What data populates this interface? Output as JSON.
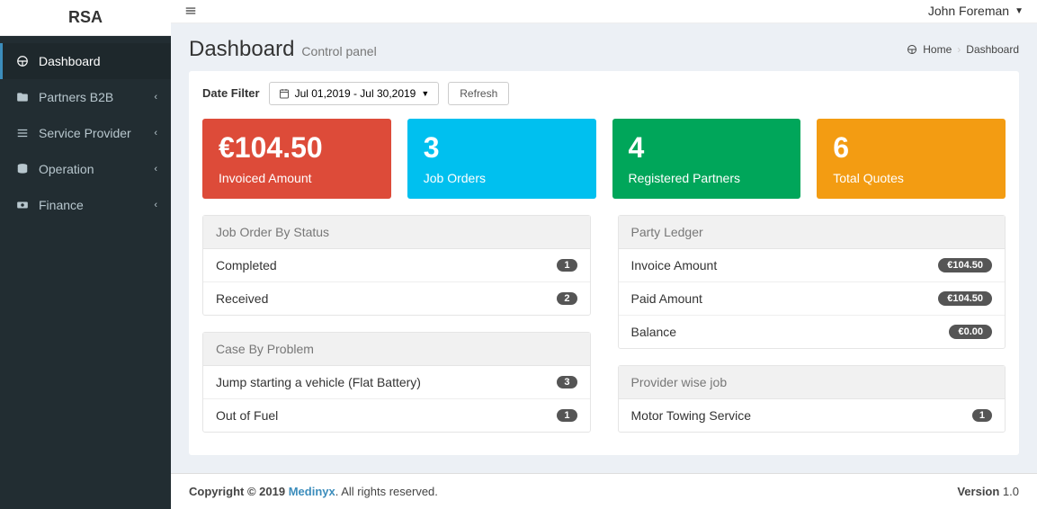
{
  "brand": "RSA",
  "user": {
    "name": "John Foreman"
  },
  "sidebar": {
    "items": [
      {
        "label": "Dashboard",
        "icon": "dashboard-icon",
        "active": true
      },
      {
        "label": "Partners B2B",
        "icon": "folder-icon",
        "expandable": true
      },
      {
        "label": "Service Provider",
        "icon": "list-icon",
        "expandable": true
      },
      {
        "label": "Operation",
        "icon": "database-icon",
        "expandable": true
      },
      {
        "label": "Finance",
        "icon": "money-icon",
        "expandable": true
      }
    ]
  },
  "header": {
    "title": "Dashboard",
    "subtitle": "Control panel"
  },
  "breadcrumb": {
    "home": "Home",
    "current": "Dashboard"
  },
  "filter": {
    "label": "Date Filter",
    "range": "Jul 01,2019 - Jul 30,2019",
    "refresh": "Refresh"
  },
  "stats": [
    {
      "value": "€104.50",
      "caption": "Invoiced Amount",
      "color": "red"
    },
    {
      "value": "3",
      "caption": "Job Orders",
      "color": "blue"
    },
    {
      "value": "4",
      "caption": "Registered Partners",
      "color": "green"
    },
    {
      "value": "6",
      "caption": "Total Quotes",
      "color": "orange"
    }
  ],
  "panels": {
    "job_status": {
      "title": "Job Order By Status",
      "items": [
        {
          "label": "Completed",
          "badge": "1"
        },
        {
          "label": "Received",
          "badge": "2"
        }
      ]
    },
    "case_problem": {
      "title": "Case By Problem",
      "items": [
        {
          "label": "Jump starting a vehicle (Flat Battery)",
          "badge": "3"
        },
        {
          "label": "Out of Fuel",
          "badge": "1"
        }
      ]
    },
    "party_ledger": {
      "title": "Party Ledger",
      "items": [
        {
          "label": "Invoice Amount",
          "badge": "€104.50"
        },
        {
          "label": "Paid Amount",
          "badge": "€104.50"
        },
        {
          "label": "Balance",
          "badge": "€0.00"
        }
      ]
    },
    "provider_job": {
      "title": "Provider wise job",
      "items": [
        {
          "label": "Motor Towing Service",
          "badge": "1"
        }
      ]
    }
  },
  "footer": {
    "copyright_prefix": "Copyright © 2019 ",
    "company": "Medinyx",
    "copyright_suffix": ". All rights reserved.",
    "version_label": "Version",
    "version": " 1.0"
  }
}
